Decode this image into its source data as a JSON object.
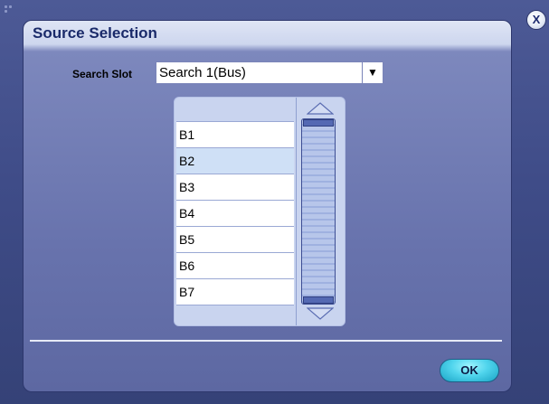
{
  "dialog": {
    "title": "Source Selection",
    "close_label": "X",
    "ok_label": "OK"
  },
  "search_slot": {
    "label": "Search Slot",
    "value": "Search 1(Bus)",
    "arrow": "▼"
  },
  "source_list": {
    "items": [
      "B1",
      "B2",
      "B3",
      "B4",
      "B5",
      "B6",
      "B7"
    ],
    "selected": "B2"
  },
  "icons": {
    "close": "close-icon",
    "dropdown": "dropdown-arrow-icon",
    "scroll_up": "scroll-up-icon",
    "scroll_down": "scroll-down-icon"
  },
  "colors": {
    "background": "#3f4c88",
    "panel_header": "#dfe5f5",
    "title_text": "#1a2a6a",
    "selected_row": "#cfe0f6",
    "ok_button": "#4fd4ec"
  }
}
